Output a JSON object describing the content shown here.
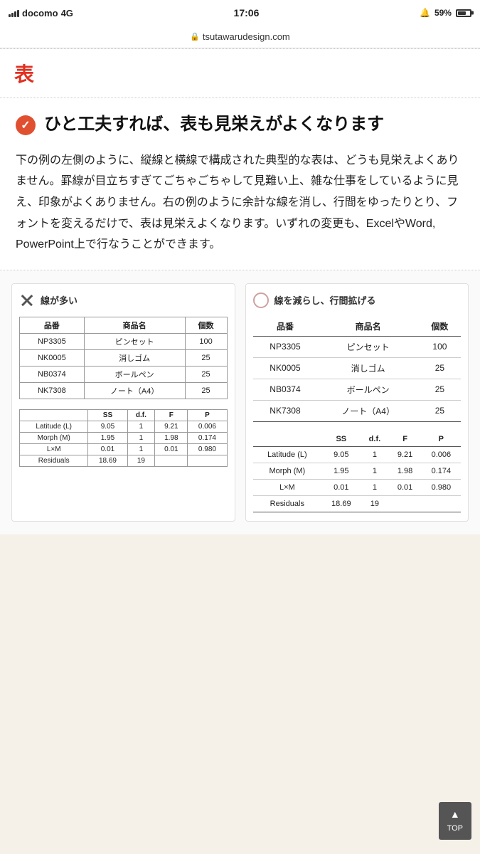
{
  "statusBar": {
    "carrier": "docomo",
    "network": "4G",
    "time": "17:06",
    "battery": "59%",
    "url": "tsutawarudesign.com"
  },
  "page": {
    "sectionTitle": "表",
    "heading": "ひと工夫すれば、表も見栄えがよくなります",
    "body": "下の例の左側のように、縦線と横線で構成された典型的な表は、どうも見栄えよくありません。罫線が目立ちすぎてごちゃごちゃして見難い上、雑な仕事をしているように見え、印象がよくありません。右の例のように余計な線を消し、行間をゆったりとり、フォントを変えるだけで、表は見栄えよくなります。いずれの変更も、ExcelやWord, PowerPoint上で行なうことができます。",
    "badLabel": "線が多い",
    "goodLabel": "線を減らし、行間拡げる",
    "table1": {
      "headers": [
        "品番",
        "商品名",
        "個数"
      ],
      "rows": [
        [
          "NP3305",
          "ピンセット",
          "100"
        ],
        [
          "NK0005",
          "消しゴム",
          "25"
        ],
        [
          "NB0374",
          "ボールペン",
          "25"
        ],
        [
          "NK7308",
          "ノート（A4）",
          "25"
        ]
      ]
    },
    "table2": {
      "headers": [
        "",
        "SS",
        "d.f.",
        "F",
        "P"
      ],
      "rows": [
        [
          "Latitude (L)",
          "9.05",
          "1",
          "9.21",
          "0.006"
        ],
        [
          "Morph (M)",
          "1.95",
          "1",
          "1.98",
          "0.174"
        ],
        [
          "L×M",
          "0.01",
          "1",
          "0.01",
          "0.980"
        ],
        [
          "Residuals",
          "18.69",
          "19",
          "",
          ""
        ]
      ]
    },
    "topButton": {
      "arrow": "▲",
      "label": "TOP"
    }
  }
}
